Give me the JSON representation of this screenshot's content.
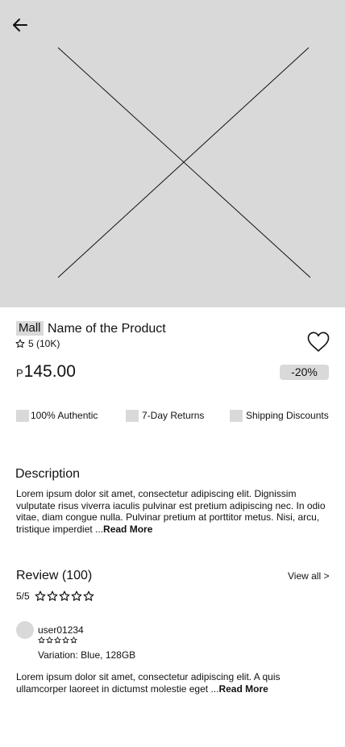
{
  "product": {
    "mall_label": "Mall",
    "name": "Name of the Product",
    "rating_text": "5 (10K)",
    "price_currency": "P",
    "price_amount": "145.00",
    "discount": "-20%"
  },
  "features": [
    {
      "label": "100% Authentic"
    },
    {
      "label": "7-Day Returns"
    },
    {
      "label": "Shipping Discounts"
    }
  ],
  "description": {
    "title": "Description",
    "body": "Lorem ipsum dolor sit amet, consectetur adipiscing elit. Dignissim vulputate risus viverra iaculis pulvinar est pretium adipiscing nec. In odio vitae, diam congue nulla. Pulvinar pretium at porttitor metus. Nisi, arcu, tristique imperdiet ...",
    "read_more": "Read More"
  },
  "reviews": {
    "title": "Review (100)",
    "view_all": "View all >",
    "score": "5/5",
    "star_count": 5,
    "items": [
      {
        "username": "user01234",
        "stars": 5,
        "variation": "Variation: Blue, 128GB",
        "body": "Lorem ipsum dolor sit amet, consectetur adipiscing elit. A quis ullamcorper laoreet in dictumst molestie eget ...",
        "read_more": "Read More"
      }
    ]
  },
  "icons": {
    "back": "arrow-left-icon",
    "wishlist": "heart-icon",
    "rating": "star-outline-icon",
    "image_placeholder": "image-placeholder-icon"
  }
}
